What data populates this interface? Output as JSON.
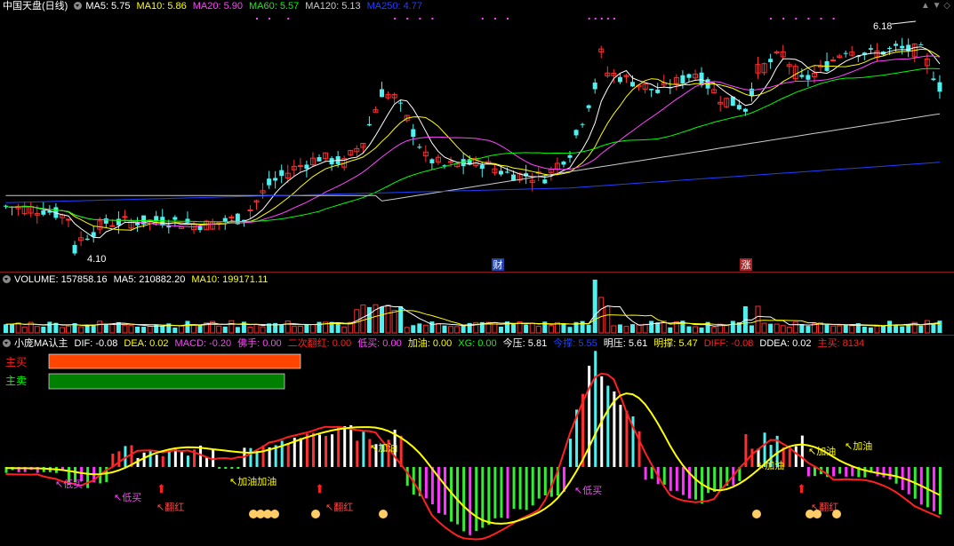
{
  "price_header": {
    "title": "中国天盘(日线)",
    "items": [
      {
        "label": "MA5: 5.75",
        "color": "#ffffff"
      },
      {
        "label": "MA10: 5.86",
        "color": "#ffff00"
      },
      {
        "label": "MA20: 5.90",
        "color": "#ff44ff"
      },
      {
        "label": "MA60: 5.57",
        "color": "#00ff00"
      },
      {
        "label": "MA120: 5.13",
        "color": "#cccccc"
      },
      {
        "label": "MA250: 4.77",
        "color": "#2040ff"
      }
    ],
    "high_label": "6.18",
    "low_label": "4.10",
    "markers": [
      "财",
      "涨"
    ]
  },
  "volume_header": {
    "items": [
      {
        "label": "VOLUME: 157858.16",
        "color": "#ffffff"
      },
      {
        "label": "MA5: 210882.20",
        "color": "#ffffff"
      },
      {
        "label": "MA10: 199171.11",
        "color": "#ffff00"
      }
    ]
  },
  "indicator_header": {
    "items": [
      {
        "label": "小庞MA认主",
        "color": "#ffffff"
      },
      {
        "label": "DIF: -0.08",
        "color": "#ffffff"
      },
      {
        "label": "DEA: 0.02",
        "color": "#ffff00"
      },
      {
        "label": "MACD: -0.20",
        "color": "#ff44ff"
      },
      {
        "label": "佛手: 0.00",
        "color": "#ff44ff"
      },
      {
        "label": "二次翻红: 0.00",
        "color": "#ff2020"
      },
      {
        "label": "低买: 0.00",
        "color": "#ff44ff"
      },
      {
        "label": "加油: 0.00",
        "color": "#ffff00"
      },
      {
        "label": "XG: 0.00",
        "color": "#00ff00"
      },
      {
        "label": "今压: 5.81",
        "color": "#ffffff"
      },
      {
        "label": "今撑: 5.55",
        "color": "#2040ff"
      },
      {
        "label": "明压: 5.61",
        "color": "#ffffff"
      },
      {
        "label": "明撑: 5.47",
        "color": "#ffff00"
      },
      {
        "label": "DIFF: -0.08",
        "color": "#ff2020"
      },
      {
        "label": "DDEA: 0.02",
        "color": "#ffffff"
      },
      {
        "label": "主买: 8134",
        "color": "#ff2020"
      }
    ],
    "buy_label": "主买",
    "sell_label": "主卖",
    "buy_strength": 0.8,
    "sell_strength": 0.75,
    "signals": [
      "低买",
      "低买",
      "翻红",
      "加油加油",
      "翻红",
      "加油",
      "低买",
      "加油",
      "加油",
      "加油",
      "翻红"
    ]
  },
  "colors": {
    "up": "#ff3030",
    "down": "#4ef0f0",
    "bg": "#000000",
    "sep": "#8b1a1a"
  },
  "chart_data": [
    {
      "type": "candlestick",
      "series": [
        {
          "name": "MA5",
          "current": 5.75
        },
        {
          "name": "MA10",
          "current": 5.86
        },
        {
          "name": "MA20",
          "current": 5.9
        },
        {
          "name": "MA60",
          "current": 5.57
        },
        {
          "name": "MA120",
          "current": 5.13
        },
        {
          "name": "MA250",
          "current": 4.77
        }
      ],
      "ylim": [
        4.0,
        6.3
      ],
      "annotations": [
        {
          "text": "6.18",
          "kind": "high"
        },
        {
          "text": "4.10",
          "kind": "low"
        }
      ]
    },
    {
      "type": "bar",
      "series": [
        {
          "name": "VOLUME",
          "current": 157858.16
        },
        {
          "name": "MA5",
          "current": 210882.2
        },
        {
          "name": "MA10",
          "current": 199171.11
        }
      ]
    },
    {
      "type": "bar",
      "series": [
        {
          "name": "DIF",
          "current": -0.08
        },
        {
          "name": "DEA",
          "current": 0.02
        },
        {
          "name": "MACD",
          "current": -0.2
        }
      ]
    }
  ]
}
